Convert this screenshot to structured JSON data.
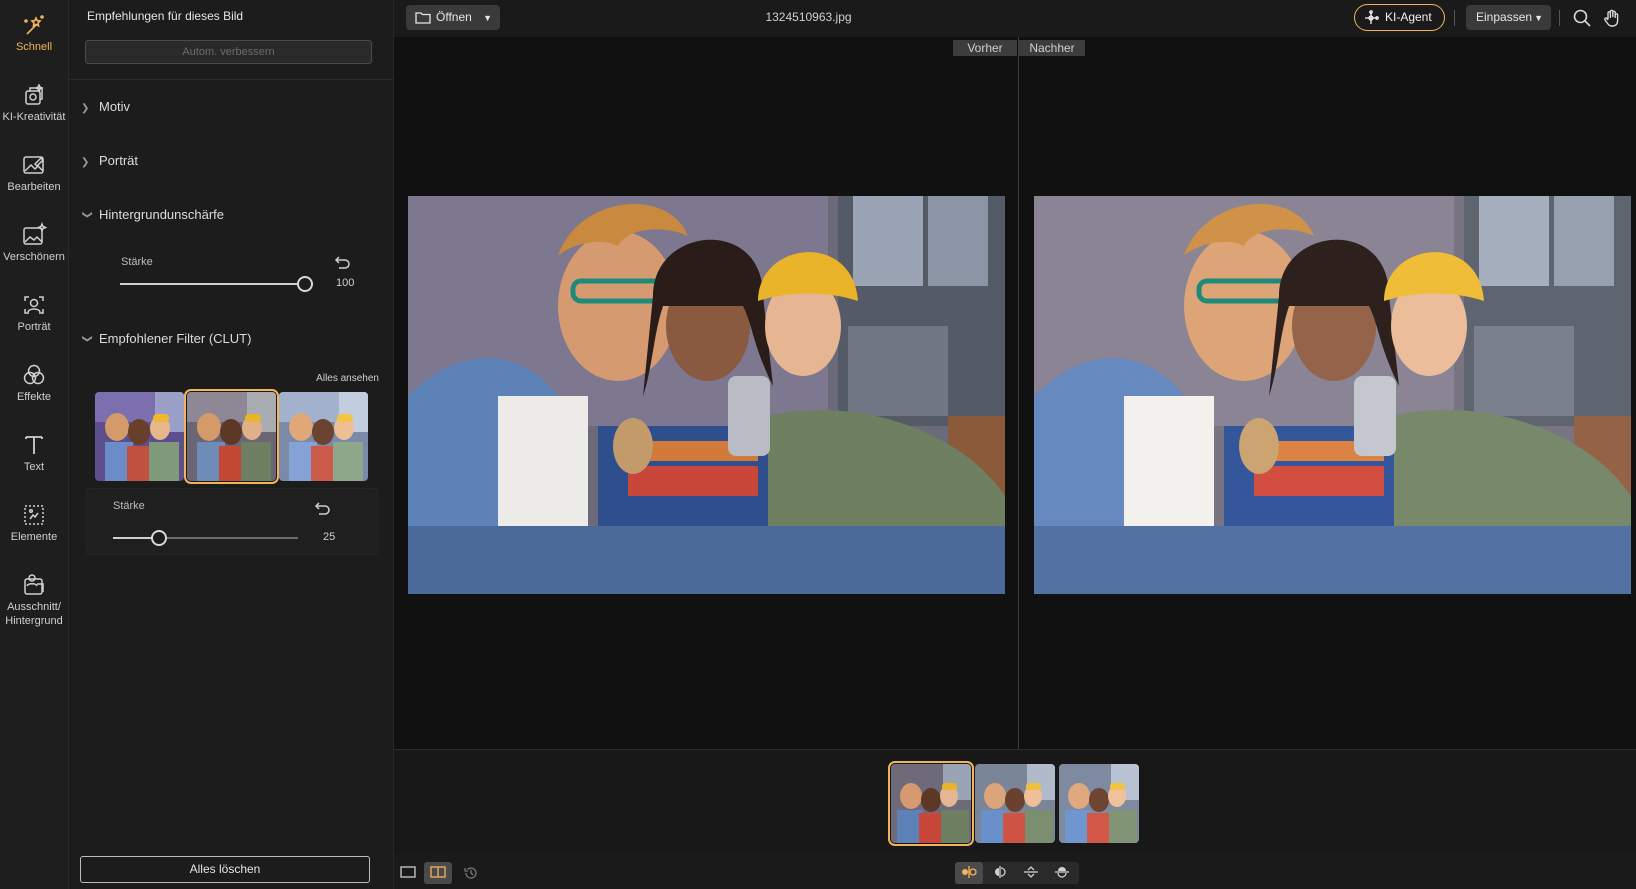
{
  "sidebar": {
    "items": [
      {
        "label": "Schnell",
        "icon": "magic-wand-icon",
        "active": true
      },
      {
        "label": "KI-Kreativität",
        "icon": "ai-creative-icon"
      },
      {
        "label": "Bearbeiten",
        "icon": "edit-image-icon"
      },
      {
        "label": "Verschönern",
        "icon": "beautify-icon"
      },
      {
        "label": "Porträt",
        "icon": "portrait-icon"
      },
      {
        "label": "Effekte",
        "icon": "effects-icon"
      },
      {
        "label": "Text",
        "icon": "text-icon"
      },
      {
        "label": "Elemente",
        "icon": "elements-icon"
      },
      {
        "label": "Ausschnitt/\nHintergrund",
        "icon": "cutout-background-icon"
      }
    ]
  },
  "panel": {
    "title": "Empfehlungen für dieses Bild",
    "auto_enhance": "Autom. verbessern",
    "sections": {
      "motiv": "Motiv",
      "portrait": "Porträt",
      "bg_blur": "Hintergrundunschärfe",
      "filter": "Empfohlener Filter (CLUT)"
    },
    "bg_blur_slider": {
      "label": "Stärke",
      "value": "100",
      "fraction": 1.0
    },
    "see_all": "Alles ansehen",
    "filter_slider": {
      "label": "Stärke",
      "value": "25",
      "fraction": 0.25
    },
    "clear_all": "Alles löschen"
  },
  "topbar": {
    "open": "Öffnen",
    "filename": "1324510963.jpg",
    "ai_agent": "KI-Agent",
    "fit": "Einpassen"
  },
  "canvas": {
    "before": "Vorher",
    "after": "Nachher"
  },
  "colors": {
    "accent": "#f2b45a",
    "bg": "#141414"
  }
}
